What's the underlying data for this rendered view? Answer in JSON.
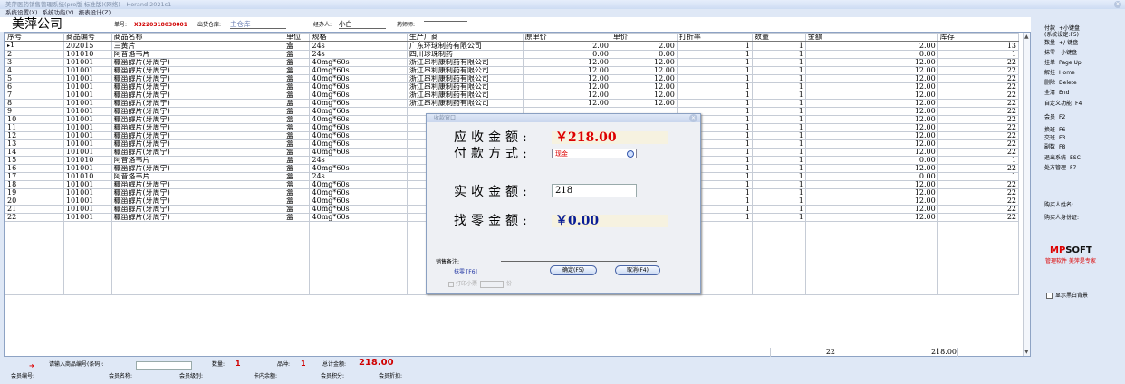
{
  "window": {
    "title": "美萍医药销售管理系统(pro版 标准版)(网络) - Horand 2021s1",
    "close_glyph": "✕"
  },
  "menu": [
    "系统设置(X)",
    "系统功能(Y)",
    "报表设计(Z)"
  ],
  "header": {
    "company": "美萍公司",
    "order_no_label": "单号:",
    "order_no": "X3220318030001",
    "warehouse_label": "出货仓库:",
    "warehouse": "主仓库",
    "handler_label": "经办人:",
    "handler": "小白",
    "pharmacist_label": "药师师:",
    "pharmacist": ""
  },
  "grid": {
    "columns": [
      "序号",
      "商品编号",
      "商品名称",
      "单位",
      "规格",
      "生产厂商",
      "原单价",
      "单价",
      "打折率",
      "数量",
      "金额",
      "库存"
    ],
    "rows": [
      [
        "1",
        "202015",
        "三黄片",
        "盒",
        "24s",
        "广东环球制药有限公司",
        "2.00",
        "2.00",
        "1",
        "1",
        "2.00",
        "13"
      ],
      [
        "2",
        "101010",
        "阿昔洛韦片",
        "盒",
        "24s",
        "四川珍珠制药",
        "0.00",
        "0.00",
        "1",
        "1",
        "0.00",
        "1"
      ],
      [
        "3",
        "101001",
        "糠甾醇片(牙周宁)",
        "盒",
        "40mg*60s",
        "浙江昂利康制药有限公司",
        "12.00",
        "12.00",
        "1",
        "1",
        "12.00",
        "22"
      ],
      [
        "4",
        "101001",
        "糠甾醇片(牙周宁)",
        "盒",
        "40mg*60s",
        "浙江昂利康制药有限公司",
        "12.00",
        "12.00",
        "1",
        "1",
        "12.00",
        "22"
      ],
      [
        "5",
        "101001",
        "糠甾醇片(牙周宁)",
        "盒",
        "40mg*60s",
        "浙江昂利康制药有限公司",
        "12.00",
        "12.00",
        "1",
        "1",
        "12.00",
        "22"
      ],
      [
        "6",
        "101001",
        "糠甾醇片(牙周宁)",
        "盒",
        "40mg*60s",
        "浙江昂利康制药有限公司",
        "12.00",
        "12.00",
        "1",
        "1",
        "12.00",
        "22"
      ],
      [
        "7",
        "101001",
        "糠甾醇片(牙周宁)",
        "盒",
        "40mg*60s",
        "浙江昂利康制药有限公司",
        "12.00",
        "12.00",
        "1",
        "1",
        "12.00",
        "22"
      ],
      [
        "8",
        "101001",
        "糠甾醇片(牙周宁)",
        "盒",
        "40mg*60s",
        "浙江昂利康制药有限公司",
        "12.00",
        "12.00",
        "1",
        "1",
        "12.00",
        "22"
      ],
      [
        "9",
        "101001",
        "糠甾醇片(牙周宁)",
        "盒",
        "40mg*60s",
        "",
        "",
        "",
        "1",
        "1",
        "12.00",
        "22"
      ],
      [
        "10",
        "101001",
        "糠甾醇片(牙周宁)",
        "盒",
        "40mg*60s",
        "",
        "",
        "",
        "1",
        "1",
        "12.00",
        "22"
      ],
      [
        "11",
        "101001",
        "糠甾醇片(牙周宁)",
        "盒",
        "40mg*60s",
        "",
        "",
        "",
        "1",
        "1",
        "12.00",
        "22"
      ],
      [
        "12",
        "101001",
        "糠甾醇片(牙周宁)",
        "盒",
        "40mg*60s",
        "",
        "",
        "",
        "1",
        "1",
        "12.00",
        "22"
      ],
      [
        "13",
        "101001",
        "糠甾醇片(牙周宁)",
        "盒",
        "40mg*60s",
        "",
        "",
        "",
        "1",
        "1",
        "12.00",
        "22"
      ],
      [
        "14",
        "101001",
        "糠甾醇片(牙周宁)",
        "盒",
        "40mg*60s",
        "",
        "",
        "",
        "1",
        "1",
        "12.00",
        "22"
      ],
      [
        "15",
        "101010",
        "阿昔洛韦片",
        "盒",
        "24s",
        "",
        "",
        "",
        "1",
        "1",
        "0.00",
        "1"
      ],
      [
        "16",
        "101001",
        "糠甾醇片(牙周宁)",
        "盒",
        "40mg*60s",
        "",
        "",
        "",
        "1",
        "1",
        "12.00",
        "22"
      ],
      [
        "17",
        "101010",
        "阿昔洛韦片",
        "盒",
        "24s",
        "",
        "",
        "",
        "1",
        "1",
        "0.00",
        "1"
      ],
      [
        "18",
        "101001",
        "糠甾醇片(牙周宁)",
        "盒",
        "40mg*60s",
        "",
        "",
        "",
        "1",
        "1",
        "12.00",
        "22"
      ],
      [
        "19",
        "101001",
        "糠甾醇片(牙周宁)",
        "盒",
        "40mg*60s",
        "",
        "",
        "",
        "1",
        "1",
        "12.00",
        "22"
      ],
      [
        "20",
        "101001",
        "糠甾醇片(牙周宁)",
        "盒",
        "40mg*60s",
        "",
        "",
        "",
        "1",
        "1",
        "12.00",
        "22"
      ],
      [
        "21",
        "101001",
        "糠甾醇片(牙周宁)",
        "盒",
        "40mg*60s",
        "",
        "",
        "",
        "1",
        "1",
        "12.00",
        "22"
      ],
      [
        "22",
        "101001",
        "糠甾醇片(牙周宁)",
        "盒",
        "40mg*60s",
        "",
        "",
        "",
        "1",
        "1",
        "12.00",
        "22"
      ]
    ],
    "current_row_marker": "▸",
    "total_qty": "22",
    "total_amount": "218.00"
  },
  "bottom": {
    "code_label": "请输入商品编号(条码):",
    "qty_label": "数量:",
    "qty": "1",
    "kinds_label": "品种:",
    "kinds": "1",
    "total_label": "总计金额:",
    "total": "218.00",
    "member_no": "会员编号:",
    "member_name": "会员名称:",
    "member_level": "会员级别:",
    "card_balance": "卡内余额:",
    "member_points": "会员积分:",
    "member_discount": "会员折扣:"
  },
  "shortcuts": [
    [
      "付款",
      "+小键盘"
    ],
    [
      "(系统设定:F5)",
      ""
    ],
    [
      "数量",
      "+/-键盘"
    ],
    [
      "抹零",
      "-小键盘"
    ],
    [
      "挂单",
      "Page Up"
    ],
    [
      "解挂",
      "Home"
    ],
    [
      "删除",
      "Delete"
    ],
    [
      "全清",
      "End"
    ],
    [
      "自定义功能",
      "F4"
    ],
    [
      "会员",
      "F2"
    ],
    [
      "换班",
      "F6"
    ],
    [
      "交班",
      "F3"
    ],
    [
      "副数",
      "F8"
    ],
    [
      "退出系统",
      "ESC"
    ],
    [
      "处方管理",
      "F7"
    ]
  ],
  "buyer": {
    "name_label": "购买人姓名:",
    "id_label": "购买人身份证:"
  },
  "brand": {
    "logo_a": "M",
    "logo_b": "P",
    "logo_c": "SOFT",
    "tagline": "管理软件 美萍是专家"
  },
  "show_bg_label": "显示黑白背景",
  "dialog": {
    "title": "收款窗口",
    "receivable_label": "应收金额:",
    "receivable": "￥218.00",
    "pay_method_label": "付款方式:",
    "pay_method": "现金",
    "received_label": "实收金额:",
    "received": "218",
    "change_label": "找零金额:",
    "change": "￥0.00",
    "note_label": "销售备注:",
    "wipe_label": "抹零 [F6]",
    "ok_label": "确定(F5)",
    "cancel_label": "取消(F4)",
    "print_label": "打印小票",
    "print_unit": "份"
  },
  "colors": {
    "accent_red": "#d00000",
    "change_blue": "#0a1e96",
    "panel_bg": "#dfe8f6"
  }
}
